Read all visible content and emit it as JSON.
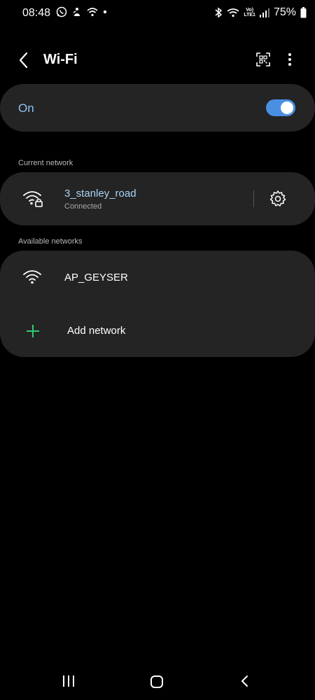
{
  "status_bar": {
    "time": "08:48",
    "battery_percent": "75%",
    "network_label_top": "Vo)",
    "network_label_bottom": "LTE1",
    "left_icons": [
      "whatsapp-icon",
      "fire-person-icon",
      "wifi-status-icon",
      "dot-icon"
    ],
    "right_icons": [
      "bluetooth-icon",
      "wifi-status-icon",
      "signal-icon",
      "battery-icon"
    ]
  },
  "header": {
    "title": "Wi-Fi",
    "icons": [
      "back-arrow-icon",
      "qr-code-icon",
      "more-options-icon"
    ]
  },
  "wifi_toggle": {
    "label": "On",
    "enabled": true
  },
  "current_network": {
    "section_label": "Current network",
    "name": "3_stanley_road",
    "status": "Connected",
    "icons": [
      "wifi-lock-icon",
      "gear-icon"
    ]
  },
  "available_networks": {
    "section_label": "Available networks",
    "items": [
      {
        "name": "AP_GEYSER",
        "icon": "wifi-icon"
      }
    ],
    "add_network_label": "Add network"
  },
  "nav_bar": {
    "icons": [
      "recents-icon",
      "home-icon",
      "back-icon"
    ]
  },
  "colors": {
    "background": "#000000",
    "card": "#242424",
    "accent": "#4a90e2",
    "link_text": "#a9d4f8",
    "add_icon": "#2ecc71"
  }
}
